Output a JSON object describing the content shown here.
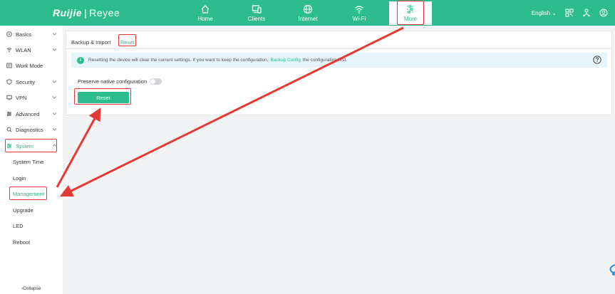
{
  "brand": {
    "name_left": "Ruijie",
    "separator": "|",
    "name_right": "Reyee"
  },
  "nav": [
    {
      "label": "Home",
      "icon": "home-icon"
    },
    {
      "label": "Clients",
      "icon": "clients-icon"
    },
    {
      "label": "Internet",
      "icon": "globe-icon"
    },
    {
      "label": "Wi-Fi",
      "icon": "wifi-icon"
    },
    {
      "label": "More",
      "icon": "more-icon"
    }
  ],
  "language": "English",
  "sidebar": {
    "items": [
      {
        "label": "Basics",
        "icon": "basics-icon"
      },
      {
        "label": "WLAN",
        "icon": "wlan-icon"
      },
      {
        "label": "Work Mode",
        "icon": "workmode-icon"
      },
      {
        "label": "Security",
        "icon": "security-icon"
      },
      {
        "label": "VPN",
        "icon": "vpn-icon"
      },
      {
        "label": "Advanced",
        "icon": "advanced-icon"
      },
      {
        "label": "Diagnostics",
        "icon": "diagnostics-icon"
      },
      {
        "label": "System",
        "icon": "system-icon"
      }
    ],
    "sub_items": [
      "System Time",
      "Login",
      "Management",
      "Upgrade",
      "LED",
      "Reboot"
    ],
    "collapse": "Collapse"
  },
  "tabs": [
    "Backup & Import",
    "Reset"
  ],
  "info": {
    "before": "Resetting the device will clear the current settings. If you want to keep the configuration,",
    "link": "Backup Config",
    "after": "the configuration first."
  },
  "preserve_label": "Preserve native configuration",
  "reset_button": "Reset",
  "colors": {
    "accent": "#2cbc8e",
    "annotation_red": "#e53935"
  }
}
